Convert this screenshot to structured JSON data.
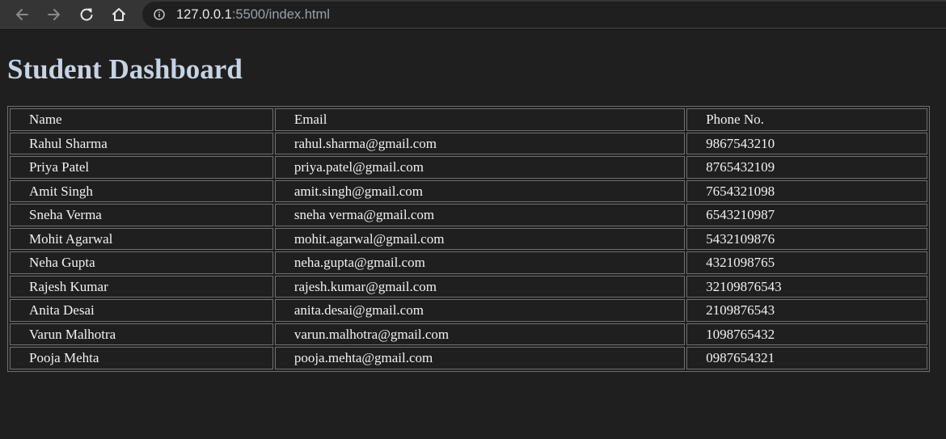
{
  "browser": {
    "url_host": "127.0.0.1",
    "url_rest": ":5500/index.html",
    "icons": {
      "back": "arrow-left-icon",
      "forward": "arrow-right-icon",
      "reload": "reload-icon",
      "home": "home-icon",
      "info": "info-icon"
    }
  },
  "page": {
    "title": "Student Dashboard"
  },
  "table": {
    "headers": [
      "Name",
      "Email",
      "Phone No."
    ],
    "rows": [
      [
        "Rahul Sharma",
        "rahul.sharma@gmail.com",
        "9867543210"
      ],
      [
        "Priya Patel",
        "priya.patel@gmail.com",
        "8765432109"
      ],
      [
        "Amit Singh",
        "amit.singh@gmail.com",
        "7654321098"
      ],
      [
        "Sneha Verma",
        "sneha verma@gmail.com",
        "6543210987"
      ],
      [
        "Mohit Agarwal",
        "mohit.agarwal@gmail.com",
        "5432109876"
      ],
      [
        "Neha Gupta",
        "neha.gupta@gmail.com",
        "4321098765"
      ],
      [
        "Rajesh Kumar",
        "rajesh.kumar@gmail.com",
        "32109876543"
      ],
      [
        "Anita Desai",
        "anita.desai@gmail.com",
        "2109876543"
      ],
      [
        "Varun Malhotra",
        "varun.malhotra@gmail.com",
        "1098765432"
      ],
      [
        "Pooja Mehta",
        "pooja.mehta@gmail.com",
        "0987654321"
      ]
    ]
  },
  "colors": {
    "page_background": "#1f1f1f",
    "toolbar_background": "#353535",
    "title_color": "#c6d3e3",
    "border_color": "#6f6f6f"
  }
}
